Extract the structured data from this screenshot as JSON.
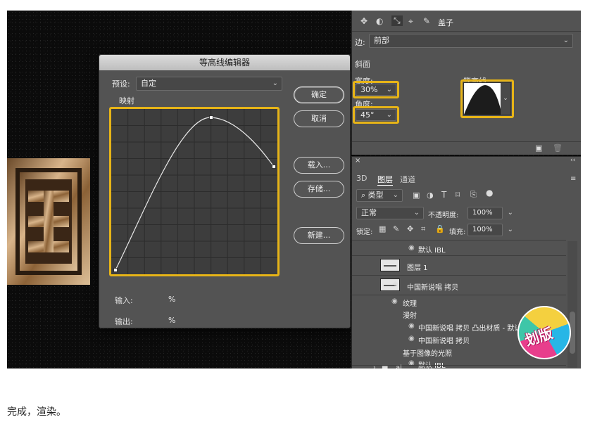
{
  "dialog": {
    "title": "等高线编辑器",
    "preset_label": "预设:",
    "preset_value": "自定",
    "mapping_label": "映射",
    "input_label": "输入:",
    "input_unit": "%",
    "output_label": "输出:",
    "output_unit": "%",
    "buttons": {
      "ok": "确定",
      "cancel": "取消",
      "load": "载入...",
      "save": "存储...",
      "new": "新建..."
    }
  },
  "properties": {
    "panel_title": "盖子",
    "edge_label": "边:",
    "edge_value": "前部",
    "bevel_label": "斜面",
    "width_label": "宽度:",
    "width_value": "30%",
    "angle_label": "角度:",
    "angle_value": "45°",
    "contour_label": "等高线:"
  },
  "layers_panel": {
    "tabs": [
      "3D",
      "图层",
      "通道"
    ],
    "active_tab": "图层",
    "filter_label": "类型",
    "blend_mode": "正常",
    "opacity_label": "不透明度:",
    "opacity_value": "100%",
    "lock_label": "锁定:",
    "fill_label": "填充:",
    "fill_value": "100%",
    "rows": {
      "default_ibl_top": "默认 IBL",
      "layer1": "图层 1",
      "copy_layer": "中国新说唱 拷贝",
      "texture": "纹理",
      "diffuse": "漫射",
      "material": "中国新说唱 拷贝 凸出材质 - 默认",
      "copy_sub": "中国新说唱 拷贝",
      "ibl": "基于图像的光照",
      "default_ibl": "默认 IBL",
      "folder": "ai"
    }
  },
  "badge_text": "划版",
  "caption": "完成，渲染。"
}
